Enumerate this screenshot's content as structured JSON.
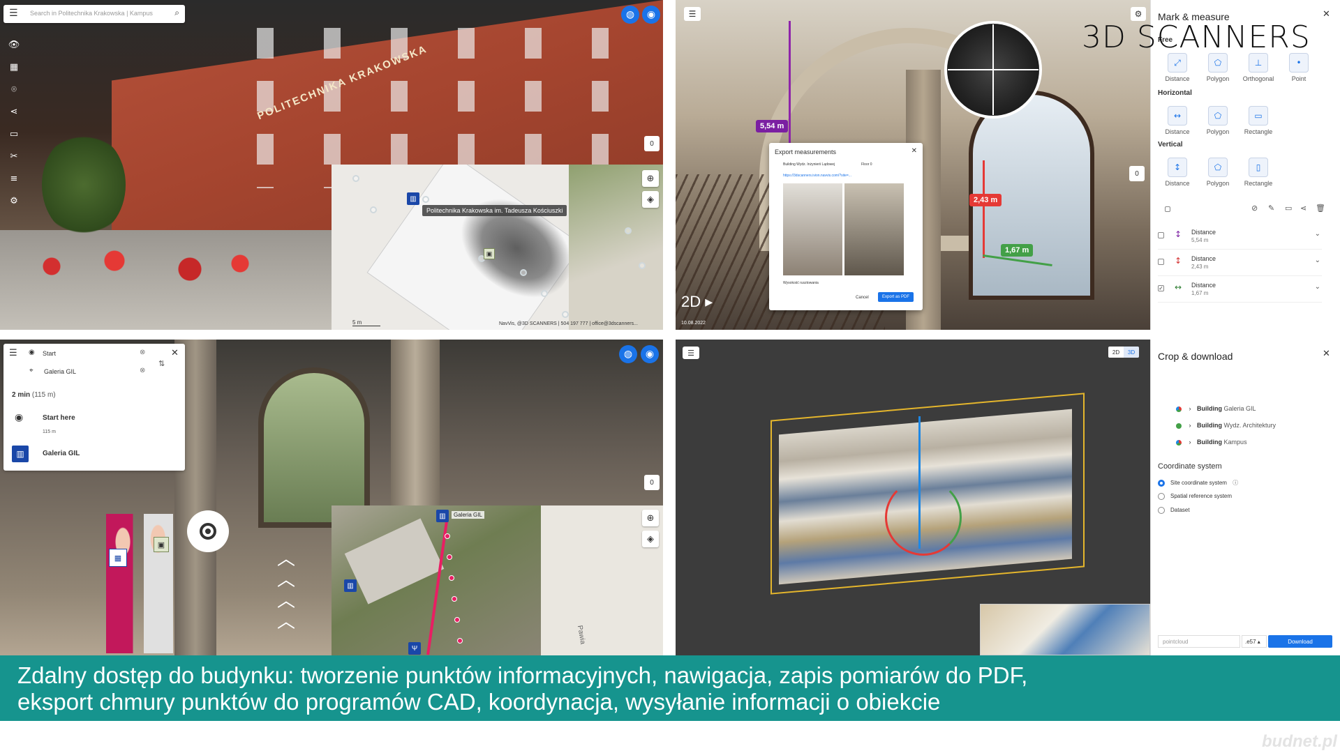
{
  "watermark": {
    "brand": "3D SCANNERS",
    "site": "budnet.pl"
  },
  "panel_tl": {
    "search_placeholder": "Search in Politechnika Krakowska | Kampus",
    "map_label": "Politechnika Krakowska im. Tadeusza Kościuszki",
    "badge_count": "0",
    "scale_text": "5 m",
    "footer_text": "NavVis, @3D SCANNERS | 504 197 777 | office@3dscanners...",
    "facade_text": "POLITECHNIKA KRAKOWSKA"
  },
  "panel_tr": {
    "title": "Mark & measure",
    "section_free": "Free",
    "free_tools": [
      "Distance",
      "Polygon",
      "Orthogonal",
      "Point"
    ],
    "section_horizontal": "Horizontal",
    "horizontal_tools": [
      "Distance",
      "Polygon",
      "Rectangle"
    ],
    "section_vertical": "Vertical",
    "vertical_tools": [
      "Distance",
      "Polygon",
      "Rectangle"
    ],
    "measurements": [
      {
        "type": "Distance",
        "value": "5,54 m",
        "color": "#7b1fa2",
        "checked": false
      },
      {
        "type": "Distance",
        "value": "2,43 m",
        "color": "#d32f2f",
        "checked": false
      },
      {
        "type": "Distance",
        "value": "1,67 m",
        "color": "#2e7d32",
        "checked": true
      }
    ],
    "label_554": "5,54 m",
    "label_243": "2,43 m",
    "label_167": "1,67 m",
    "dialog_title": "Export measurements",
    "dialog_item1": "Building Wydz. Inżynierii Lądowej",
    "dialog_item2": "Floor 0",
    "dialog_url": "https://3dscanners.ivion.navvis.com/?site=...",
    "dialog_note": "Wysokość rusztowania",
    "dialog_cancel": "Cancel",
    "dialog_export": "Export as PDF",
    "mode_2d": "2D",
    "date": "10.08.2022",
    "badge_count": "0"
  },
  "panel_bl": {
    "start": "Start",
    "destination": "Galeria GIL",
    "time": "2 min",
    "distance": "(115 m)",
    "start_here": "Start here",
    "step_distance": "115 m",
    "dest_label": "Galeria GIL",
    "map_label": "Galeria GIL",
    "street": "Pawia",
    "badge_count": "0"
  },
  "panel_br": {
    "title": "Crop & download",
    "btn_2d": "2D",
    "btn_3d": "3D",
    "buildings": [
      {
        "kind": "Building",
        "name": "Galeria GIL",
        "color": "multi"
      },
      {
        "kind": "Building",
        "name": "Wydz. Architektury",
        "color": "#43a047"
      },
      {
        "kind": "Building",
        "name": "Kampus",
        "color": "multi"
      }
    ],
    "coord_title": "Coordinate system",
    "coord_options": [
      "Site coordinate system",
      "Spatial reference system",
      "Dataset"
    ],
    "filename_placeholder": "pointcloud",
    "format": ".e57",
    "download": "Download"
  },
  "caption": {
    "line1": "Zdalny dostęp do budynku: tworzenie punktów informacyjnych, nawigacja, zapis pomiarów do PDF,",
    "line2": "eksport chmury punktów do programów CAD, koordynacja, wysyłanie informacji o obiekcie",
    "bg": "#16948e"
  }
}
